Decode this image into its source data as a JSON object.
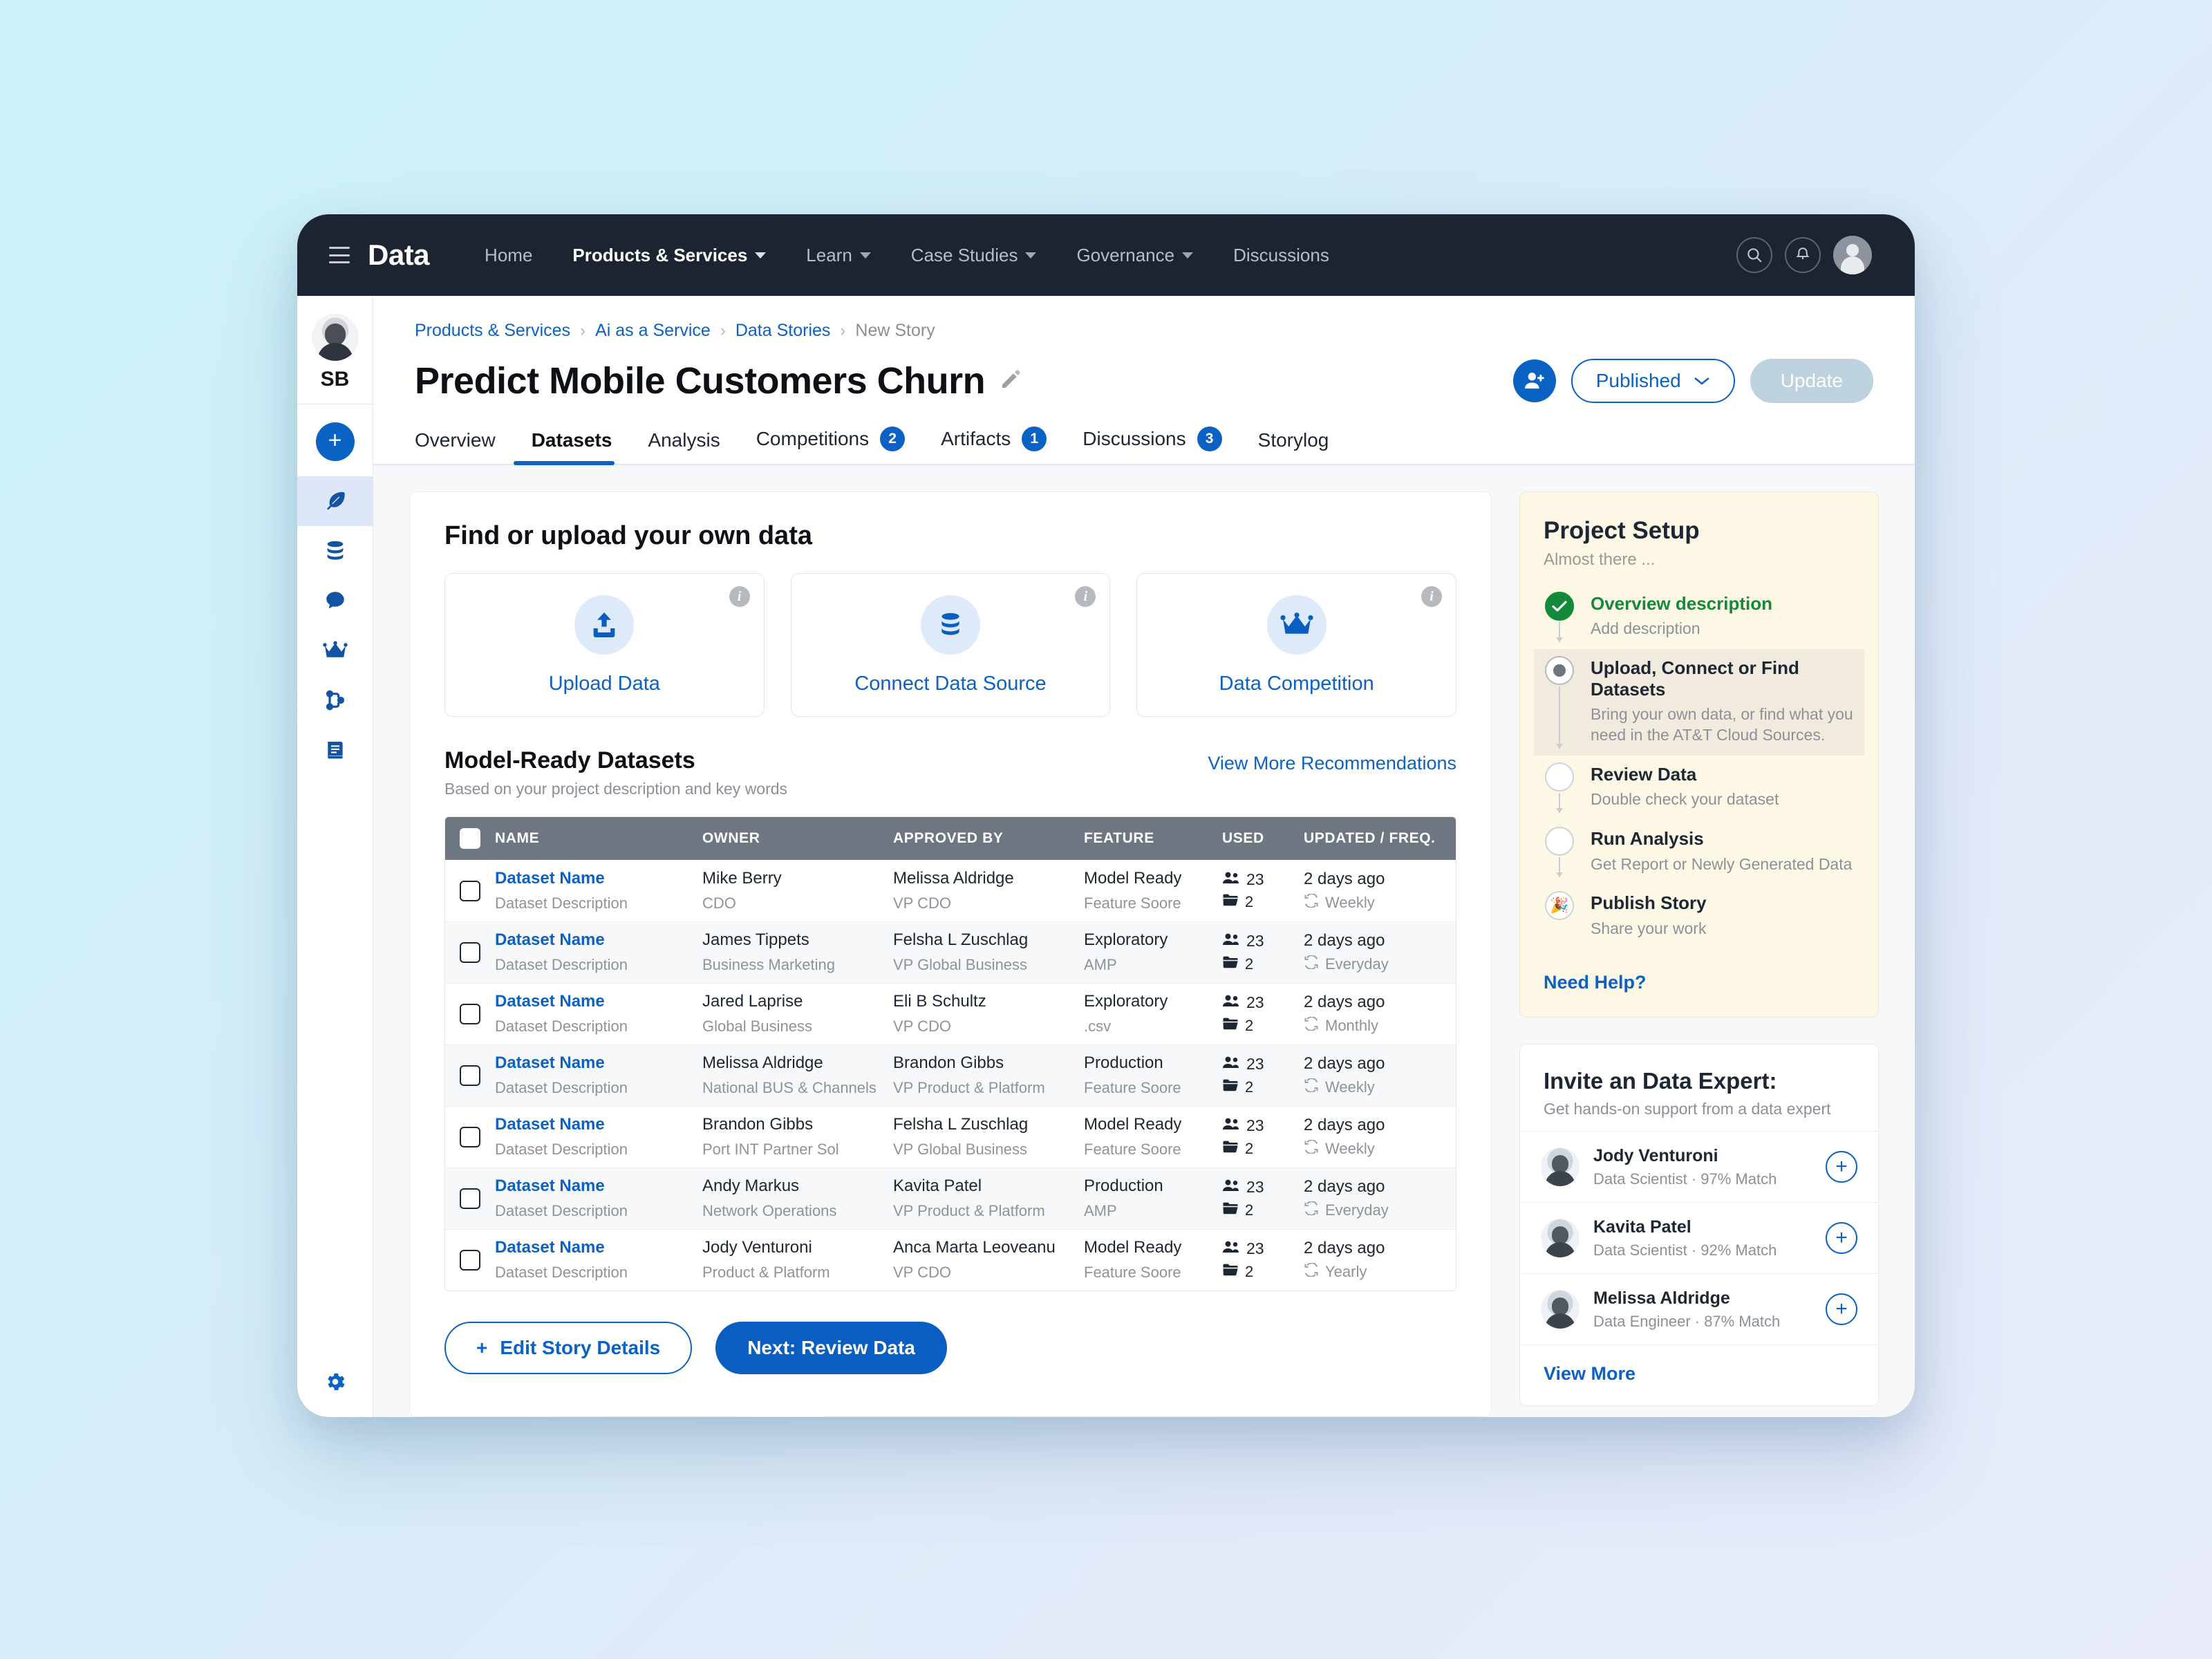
{
  "topnav": {
    "brand": "Data",
    "links": [
      {
        "label": "Home",
        "caret": false,
        "active": false
      },
      {
        "label": "Products & Services",
        "caret": true,
        "active": true
      },
      {
        "label": "Learn",
        "caret": true,
        "active": false
      },
      {
        "label": "Case Studies",
        "caret": true,
        "active": false
      },
      {
        "label": "Governance",
        "caret": true,
        "active": false
      },
      {
        "label": "Discussions",
        "caret": false,
        "active": false
      }
    ]
  },
  "rail": {
    "initials": "SB",
    "add_label": "+",
    "items": [
      {
        "icon": "feather-icon",
        "active": true
      },
      {
        "icon": "database-icon",
        "active": false
      },
      {
        "icon": "chat-icon",
        "active": false
      },
      {
        "icon": "crown-icon",
        "active": false
      },
      {
        "icon": "branch-icon",
        "active": false
      },
      {
        "icon": "book-icon",
        "active": false
      }
    ]
  },
  "breadcrumb": [
    {
      "label": "Products & Services",
      "last": false
    },
    {
      "label": "Ai as a Service",
      "last": false
    },
    {
      "label": "Data Stories",
      "last": false
    },
    {
      "label": "New Story",
      "last": true
    }
  ],
  "header": {
    "title": "Predict Mobile Customers Churn",
    "status_label": "Published",
    "update_label": "Update"
  },
  "tabs": [
    {
      "label": "Overview",
      "badge": null,
      "active": false
    },
    {
      "label": "Datasets",
      "badge": null,
      "active": true
    },
    {
      "label": "Analysis",
      "badge": null,
      "active": false
    },
    {
      "label": "Competitions",
      "badge": "2",
      "active": false
    },
    {
      "label": "Artifacts",
      "badge": "1",
      "active": false
    },
    {
      "label": "Discussions",
      "badge": "3",
      "active": false
    },
    {
      "label": "Storylog",
      "badge": null,
      "active": false
    }
  ],
  "find": {
    "title": "Find or upload your own data",
    "cards": [
      {
        "label": "Upload Data",
        "icon": "upload-icon"
      },
      {
        "label": "Connect Data Source",
        "icon": "database-icon"
      },
      {
        "label": "Data Competition",
        "icon": "crown-icon"
      }
    ]
  },
  "datasets": {
    "title": "Model-Ready Datasets",
    "subtitle": "Based on your project description and key words",
    "more_link": "View More Recommendations",
    "columns": [
      "NAME",
      "OWNER",
      "APPROVED BY",
      "FEATURE",
      "USED",
      "UPDATED / FREQ."
    ],
    "rows": [
      {
        "name": "Dataset Name",
        "name_sub": "Dataset Description",
        "owner": "Mike Berry",
        "owner_sub": "CDO",
        "approved": "Melissa Aldridge",
        "approved_sub": "VP CDO",
        "feature": "Model Ready",
        "feature_sub": "Feature Soore",
        "used_people": "23",
        "used_folders": "2",
        "updated": "2 days ago",
        "freq": "Weekly"
      },
      {
        "name": "Dataset Name",
        "name_sub": "Dataset Description",
        "owner": "James Tippets",
        "owner_sub": "Business Marketing",
        "approved": "Felsha L Zuschlag",
        "approved_sub": "VP Global Business",
        "feature": "Exploratory",
        "feature_sub": "AMP",
        "used_people": "23",
        "used_folders": "2",
        "updated": "2 days ago",
        "freq": "Everyday"
      },
      {
        "name": "Dataset Name",
        "name_sub": "Dataset Description",
        "owner": "Jared Laprise",
        "owner_sub": "Global Business",
        "approved": "Eli B Schultz",
        "approved_sub": "VP CDO",
        "feature": "Exploratory",
        "feature_sub": ".csv",
        "used_people": "23",
        "used_folders": "2",
        "updated": "2 days ago",
        "freq": "Monthly"
      },
      {
        "name": "Dataset Name",
        "name_sub": "Dataset Description",
        "owner": "Melissa Aldridge",
        "owner_sub": "National BUS & Channels",
        "approved": "Brandon Gibbs",
        "approved_sub": "VP Product & Platform",
        "feature": "Production",
        "feature_sub": "Feature Soore",
        "used_people": "23",
        "used_folders": "2",
        "updated": "2 days ago",
        "freq": "Weekly"
      },
      {
        "name": "Dataset Name",
        "name_sub": "Dataset Description",
        "owner": "Brandon Gibbs",
        "owner_sub": "Port INT Partner Sol",
        "approved": "Felsha L Zuschlag",
        "approved_sub": "VP Global Business",
        "feature": "Model Ready",
        "feature_sub": "Feature Soore",
        "used_people": "23",
        "used_folders": "2",
        "updated": "2 days ago",
        "freq": "Weekly"
      },
      {
        "name": "Dataset Name",
        "name_sub": "Dataset Description",
        "owner": "Andy Markus",
        "owner_sub": "Network Operations",
        "approved": "Kavita Patel",
        "approved_sub": "VP Product & Platform",
        "feature": "Production",
        "feature_sub": "AMP",
        "used_people": "23",
        "used_folders": "2",
        "updated": "2 days ago",
        "freq": "Everyday"
      },
      {
        "name": "Dataset Name",
        "name_sub": "Dataset Description",
        "owner": "Jody Venturoni",
        "owner_sub": "Product & Platform",
        "approved": "Anca Marta Leoveanu",
        "approved_sub": "VP CDO",
        "feature": "Model Ready",
        "feature_sub": "Feature Soore",
        "used_people": "23",
        "used_folders": "2",
        "updated": "2 days ago",
        "freq": "Yearly"
      }
    ]
  },
  "actions": {
    "edit_label": "Edit Story Details",
    "next_label": "Next: Review Data"
  },
  "setup": {
    "title": "Project Setup",
    "subtitle": "Almost there ...",
    "help_link": "Need Help?",
    "steps": [
      {
        "title": "Overview description",
        "desc": "Add description",
        "state": "done"
      },
      {
        "title": "Upload, Connect or Find Datasets",
        "desc": "Bring your own data, or find what you need in the AT&T Cloud Sources.",
        "state": "current"
      },
      {
        "title": "Review Data",
        "desc": "Double check your dataset",
        "state": "todo"
      },
      {
        "title": "Run Analysis",
        "desc": "Get Report or Newly Generated Data",
        "state": "todo"
      },
      {
        "title": "Publish Story",
        "desc": "Share your work",
        "state": "party"
      }
    ]
  },
  "experts": {
    "title": "Invite an Data Expert:",
    "subtitle": "Get hands-on support from a data expert",
    "view_more": "View More",
    "list": [
      {
        "name": "Jody Venturoni",
        "meta": "Data Scientist  ·  97% Match"
      },
      {
        "name": "Kavita Patel",
        "meta": "Data Scientist  ·  92% Match"
      },
      {
        "name": "Melissa Aldridge",
        "meta": "Data Engineer  ·  87% Match"
      }
    ]
  },
  "colors": {
    "brand_blue": "#0b62c4",
    "nav_dark": "#1b2430",
    "success_green": "#138a3a",
    "table_header": "#6e7681",
    "panel_cream": "#fdf8e6"
  }
}
